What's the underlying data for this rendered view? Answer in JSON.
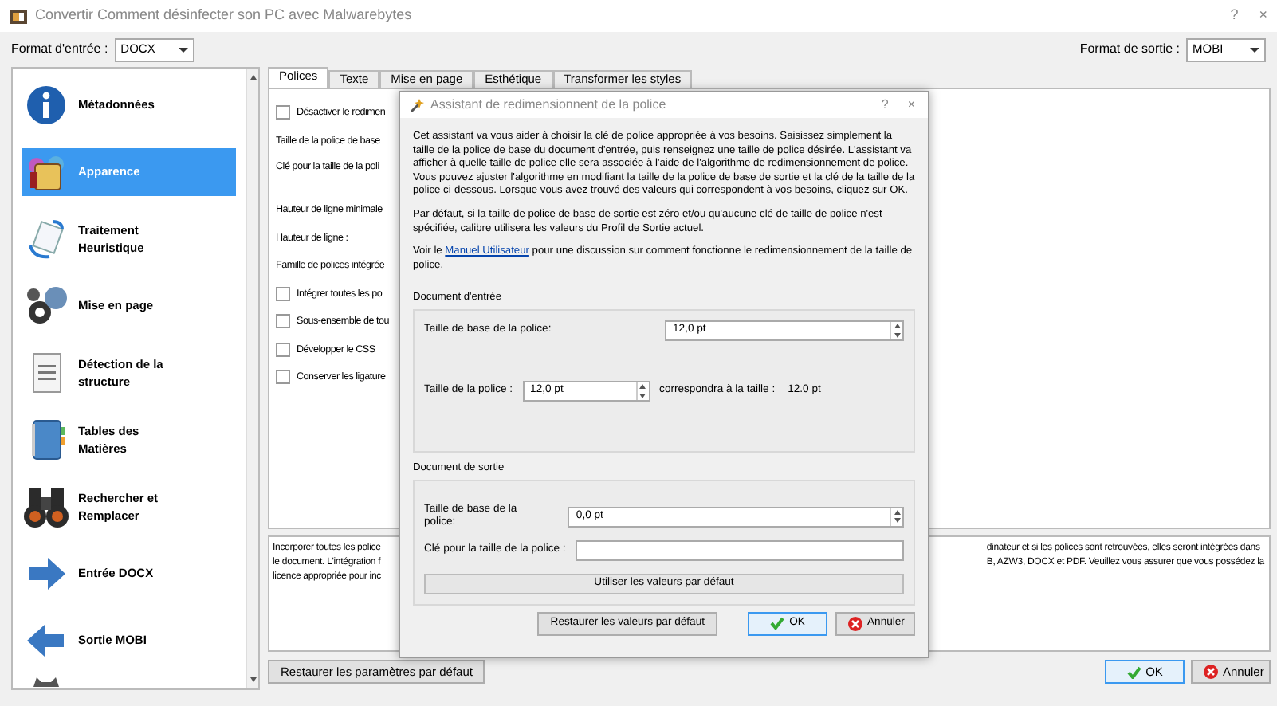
{
  "window": {
    "title": "Convertir Comment désinfecter son PC avec Malwarebytes",
    "help": "?",
    "close": "×"
  },
  "input_format": {
    "label": "Format d'entrée :",
    "value": "DOCX"
  },
  "output_format": {
    "label": "Format de sortie :",
    "value": "MOBI"
  },
  "sidebar": {
    "items": [
      {
        "label": "Métadonnées",
        "selected": false
      },
      {
        "label": "Apparence",
        "selected": true
      },
      {
        "label": "Traitement Heuristique",
        "selected": false
      },
      {
        "label": "Mise en page",
        "selected": false
      },
      {
        "label": "Détection de la structure",
        "selected": false
      },
      {
        "label": "Tables des Matières",
        "selected": false
      },
      {
        "label": "Rechercher et Remplacer",
        "selected": false
      },
      {
        "label": "Entrée DOCX",
        "selected": false
      },
      {
        "label": "Sortie MOBI",
        "selected": false
      }
    ]
  },
  "tabs": [
    {
      "label": "Polices",
      "selected": true
    },
    {
      "label": "Texte",
      "selected": false
    },
    {
      "label": "Mise en page",
      "selected": false
    },
    {
      "label": "Esthétique",
      "selected": false
    },
    {
      "label": "Transformer les styles",
      "selected": false
    }
  ],
  "options": [
    {
      "kind": "checkbox",
      "label": "Désactiver le redimen",
      "checked": false
    },
    {
      "kind": "label",
      "label": "Taille de la police de base"
    },
    {
      "kind": "label",
      "label": "Clé pour la taille de la poli"
    },
    {
      "kind": "label",
      "label": "Hauteur de ligne minimale"
    },
    {
      "kind": "label",
      "label": "Hauteur de ligne :"
    },
    {
      "kind": "label",
      "label": "Famille de polices intégrée"
    },
    {
      "kind": "checkbox",
      "label": "Intégrer toutes les po",
      "checked": false
    },
    {
      "kind": "checkbox",
      "label": "Sous-ensemble de tou",
      "checked": false
    },
    {
      "kind": "checkbox",
      "label": "Développer le CSS",
      "checked": false
    },
    {
      "kind": "checkbox",
      "label": "Conserver les ligature",
      "checked": false
    }
  ],
  "description": {
    "left_lines": [
      "Incorporer toutes les police",
      "le document. L'intégration f",
      "licence appropriée pour inc"
    ],
    "right_lines": [
      "dinateur et si les polices sont retrouvées, elles seront intégrées dans",
      "B, AZW3, DOCX et PDF. Veuillez vous assurer que vous possédez la"
    ]
  },
  "restore_defaults_button": "Restaurer les paramètres par défaut",
  "ok_button": "OK",
  "cancel_button": "Annuler",
  "dialog": {
    "title": "Assistant de redimensionnent de la police",
    "help": "?",
    "close": "×",
    "paragraphs": [
      "Cet assistant va vous aider à choisir la clé de police appropriée à vos besoins. Saisissez simplement la taille de la police de base du document d'entrée, puis renseignez une taille de police désirée. L'assistant va afficher à quelle taille de police elle sera associée à l'aide de l'algorithme de redimensionnement de police. Vous pouvez ajuster l'algorithme en modifiant la taille de la police de base de sortie et la clé de la taille de la police ci-dessous. Lorsque vous avez trouvé des valeurs qui correspondent à vos besoins, cliquez sur OK.",
      "Par défaut, si la taille de police de base de sortie est zéro et/ou qu'aucune clé de taille de police n'est spécifiée, calibre utilisera les valeurs du Profil de Sortie actuel."
    ],
    "help_text": {
      "before": "Voir le ",
      "link": "Manuel Utilisateur",
      "after": " pour une discussion sur comment fonctionne le redimensionnement de la taille de police."
    },
    "input_group": {
      "title": "Document d'entrée",
      "base_size_label": "Taille de base de la police:",
      "base_size_value": "12,0 pt",
      "size_label": "Taille de la police :",
      "size_value": "12,0 pt",
      "maps_label": "correspondra à la taille :",
      "maps_value": "12.0 pt"
    },
    "output_group": {
      "title": "Document de sortie",
      "base_size_label": "Taille de base de la police:",
      "base_size_value": "0,0 pt",
      "key_label": "Clé pour la taille de la police :",
      "defaults_button": "Utiliser les valeurs par défaut"
    },
    "restore_button": "Restaurer les valeurs par défaut",
    "ok_button": "OK",
    "cancel_button": "Annuler"
  }
}
